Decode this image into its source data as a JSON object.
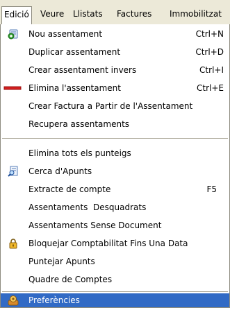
{
  "menubar": {
    "items": [
      {
        "label": "Edició"
      },
      {
        "label": "Veure"
      },
      {
        "label": "Llistats"
      },
      {
        "label": "Factures"
      },
      {
        "label": "Immobilitzat"
      }
    ]
  },
  "menu": {
    "items": [
      {
        "label": "Nou assentament",
        "shortcut": "Ctrl+N",
        "icon": "new-entry-icon"
      },
      {
        "label": "Duplicar assentament",
        "shortcut": "Ctrl+D"
      },
      {
        "label": "Crear assentament invers",
        "shortcut": "Ctrl+I"
      },
      {
        "label": "Elimina l'assentament",
        "shortcut": "Ctrl+E",
        "icon": "delete-icon"
      },
      {
        "label": "Crear Factura a Partir de l'Assentament"
      },
      {
        "label": "Recupera assentaments"
      },
      {
        "label": "Elimina tots els punteigs"
      },
      {
        "label": "Cerca d'Apunts",
        "icon": "search-document-icon"
      },
      {
        "label": "Extracte de compte",
        "shortcut": "F5"
      },
      {
        "label": "Assentaments  Desquadrats"
      },
      {
        "label": "Assentaments Sense Document"
      },
      {
        "label": "Bloquejar Comptabilitat Fins Una Data",
        "icon": "lock-icon"
      },
      {
        "label": "Puntejar Apunts"
      },
      {
        "label": "Quadre de Comptes"
      },
      {
        "label": "Preferències",
        "icon": "preferences-icon",
        "highlighted": true
      }
    ]
  },
  "colors": {
    "highlight": "#316ac5",
    "menubar_bg": "#ece9d8"
  }
}
